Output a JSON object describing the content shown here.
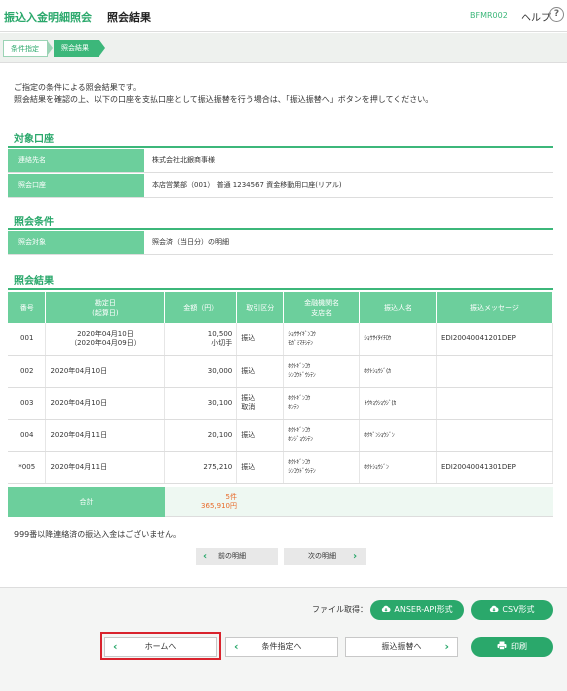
{
  "header": {
    "service_title": "振込入金明細照会",
    "screen_title": "照会結果",
    "screen_id": "BFMR002",
    "help_label": "ヘルプ",
    "help_icon": "?"
  },
  "breadcrumb": {
    "steps": [
      "条件指定",
      "照会結果"
    ]
  },
  "intro": {
    "line1": "ご指定の条件による照会結果です。",
    "line2": "照会結果を確認の上、以下の口座を支払口座として振込振替を行う場合は、「振込振替へ」ボタンを押してください。"
  },
  "target_account": {
    "heading": "対象口座",
    "rows": [
      {
        "label": "連絡先名",
        "value": "株式会社北銀商事様"
      },
      {
        "label": "照会口座",
        "value": "本店営業部（001） 普通 1234567 資金移動用口座(リアル)"
      }
    ]
  },
  "conditions": {
    "heading": "照会条件",
    "rows": [
      {
        "label": "照会対象",
        "value": "照会済（当日分）の明細"
      }
    ]
  },
  "results": {
    "heading": "照会結果",
    "columns": {
      "no": "番号",
      "date1": "勘定日",
      "date2": "(起算日)",
      "amount": "金額（円）",
      "type": "取引区分",
      "bank1": "金融機関名",
      "bank2": "支店名",
      "payer": "振込人名",
      "message": "振込メッセージ"
    },
    "rows": [
      {
        "no": "001",
        "date": "2020年04月10日",
        "date_sub": "（2020年04月09日）",
        "amount": "10,500",
        "amount_sub": "小切手",
        "type": "振込",
        "type_sub": "",
        "bank": "ｼｮｳｻｲｷﾞﾝｺｳ",
        "branch": "ﾓｶﾞﾐﾏﾁｼﾃﾝ",
        "payer": "ｼｮｳｻｲﾀｲﾁﾛｳ",
        "message": "EDI20040041201DEP"
      },
      {
        "no": "002",
        "date": "2020年04月10日",
        "date_sub": "",
        "amount": "30,000",
        "amount_sub": "",
        "type": "振込",
        "type_sub": "",
        "bank": "ﾎｸﾄｷﾞﾝｺｳ",
        "branch": "ｼﾝｺｳﾄﾞｳｼﾃﾝ",
        "payer": "ﾎｸﾄｼｮｳｼﾞ(ｶ",
        "message": ""
      },
      {
        "no": "003",
        "date": "2020年04月10日",
        "date_sub": "",
        "amount": "30,100",
        "amount_sub": "",
        "type": "振込",
        "type_sub": "取消",
        "bank": "ﾎｸﾄｷﾞﾝｺｳ",
        "branch": "ﾎﾝﾃﾝ",
        "payer": "ﾄｳｷｮｳｼｮｳｼﾞ(ｶ",
        "message": ""
      },
      {
        "no": "004",
        "date": "2020年04月11日",
        "date_sub": "",
        "amount": "20,100",
        "amount_sub": "",
        "type": "振込",
        "type_sub": "",
        "bank": "ﾎｸﾄｷﾞﾝｺｳ",
        "branch": "ﾎﾝｼﾞｮｳｼﾃﾝ",
        "payer": "ﾎｸｷﾞﾝｼｮｳｼﾞﾝ",
        "message": ""
      },
      {
        "no": "*005",
        "date": "2020年04月11日",
        "date_sub": "",
        "amount": "275,210",
        "amount_sub": "",
        "type": "振込",
        "type_sub": "",
        "bank": "ﾎｸﾄｷﾞﾝｺｳ",
        "branch": "ｼﾝｺｳﾄﾞｳｼﾃﾝ",
        "payer": "ﾎｸﾄｼｮｳｼﾞﾝ",
        "message": "EDI20040041301DEP"
      }
    ],
    "total_label": "合計",
    "total_count": "5件",
    "total_amount": "365,910円",
    "note": "999番以降連絡済の振込入金はございません。"
  },
  "pager": {
    "prev_label": "前の明細",
    "next_label": "次の明細"
  },
  "footer": {
    "file_label": "ファイル取得：",
    "anser_label": "ANSER-API形式",
    "csv_label": "CSV形式",
    "home_label": "ホームへ",
    "condition_label": "条件指定へ",
    "transfer_label": "振込振替へ",
    "print_label": "印刷"
  },
  "colors": {
    "brand_green": "#3cb77a",
    "header_cell": "#6ccf9c",
    "highlight_red": "#d9232d"
  }
}
